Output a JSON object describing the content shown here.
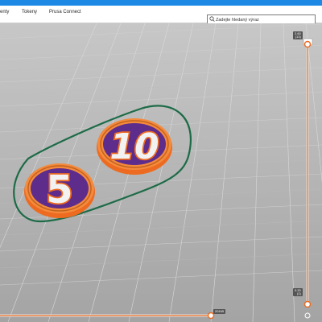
{
  "menu": {
    "items": [
      "enty",
      "Tokeny",
      "Prusa Connect"
    ]
  },
  "search": {
    "placeholder": "Zadejte hledaný výraz"
  },
  "layer_slider": {
    "top_value": "2.60",
    "top_layer": "(13)",
    "bottom_value": "0.20",
    "bottom_layer": "(1)"
  },
  "move_slider": {
    "value": "20165"
  },
  "models": {
    "coin_1_text": "5",
    "coin_2_text": "10"
  },
  "colors": {
    "accent": "#ed6b21",
    "coin_fill": "#5e2d8c",
    "skirt": "#1d6b47",
    "titlebar": "#1e88e5"
  }
}
